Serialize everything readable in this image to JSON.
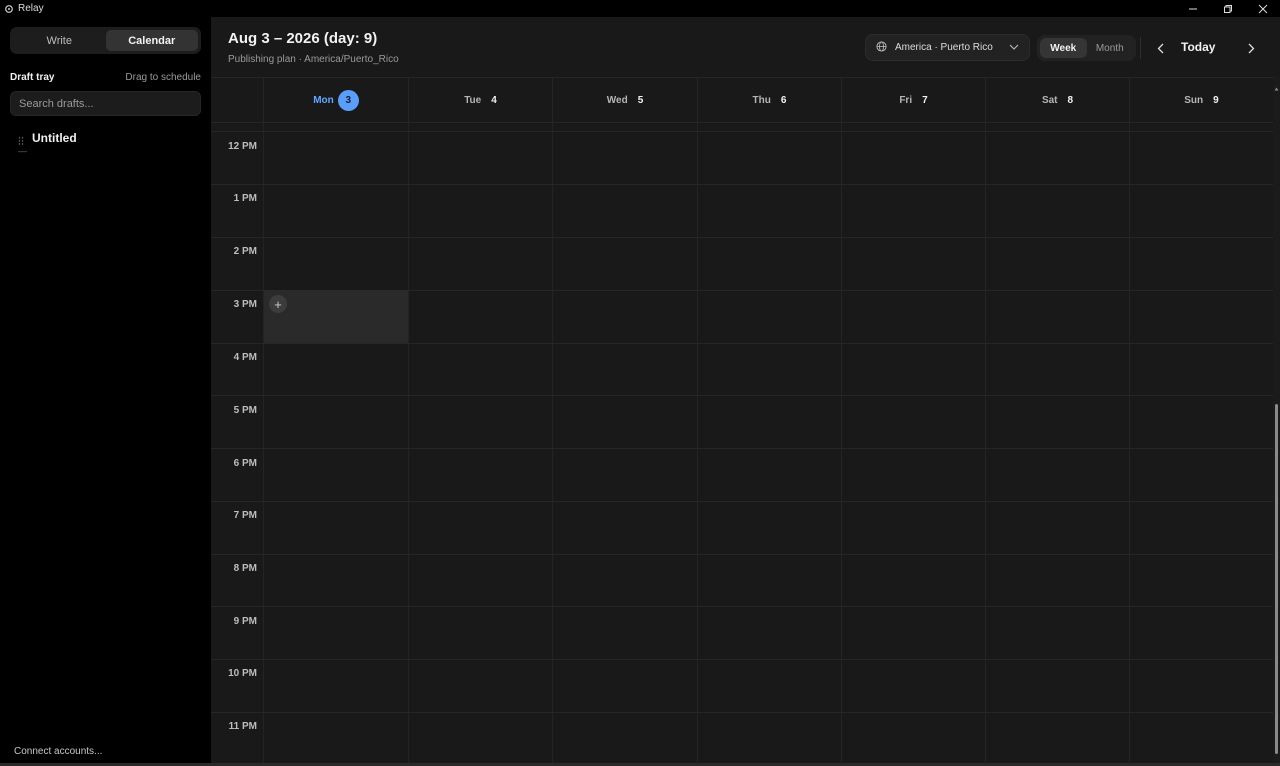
{
  "app": {
    "title": "Relay"
  },
  "sidebar": {
    "tabs": [
      {
        "label": "Write"
      },
      {
        "label": "Calendar"
      }
    ],
    "tray_title": "Draft tray",
    "tray_hint": "Drag to schedule",
    "search_placeholder": "Search drafts...",
    "drafts": [
      {
        "title": "Untitled",
        "meta": "—"
      }
    ],
    "connect_label": "Connect accounts..."
  },
  "header": {
    "title": "Aug 3 – 2026 (day: 9)",
    "subtitle": "Publishing plan · America/Puerto_Rico",
    "timezone": "America · Puerto Rico",
    "views": [
      {
        "label": "Week"
      },
      {
        "label": "Month"
      }
    ],
    "today_label": "Today"
  },
  "calendar": {
    "days": [
      {
        "name": "Mon",
        "num": "3"
      },
      {
        "name": "Tue",
        "num": "4"
      },
      {
        "name": "Wed",
        "num": "5"
      },
      {
        "name": "Thu",
        "num": "6"
      },
      {
        "name": "Fri",
        "num": "7"
      },
      {
        "name": "Sat",
        "num": "8"
      },
      {
        "name": "Sun",
        "num": "9"
      }
    ],
    "hours": [
      "12 PM",
      "1 PM",
      "2 PM",
      "3 PM",
      "4 PM",
      "5 PM",
      "6 PM",
      "7 PM",
      "8 PM",
      "9 PM",
      "10 PM",
      "11 PM"
    ],
    "add_symbol": "+"
  },
  "colors": {
    "accent": "#5b9dfa",
    "today_text": "#62a7ff",
    "panel": "#191919",
    "sidebar": "#000000"
  }
}
